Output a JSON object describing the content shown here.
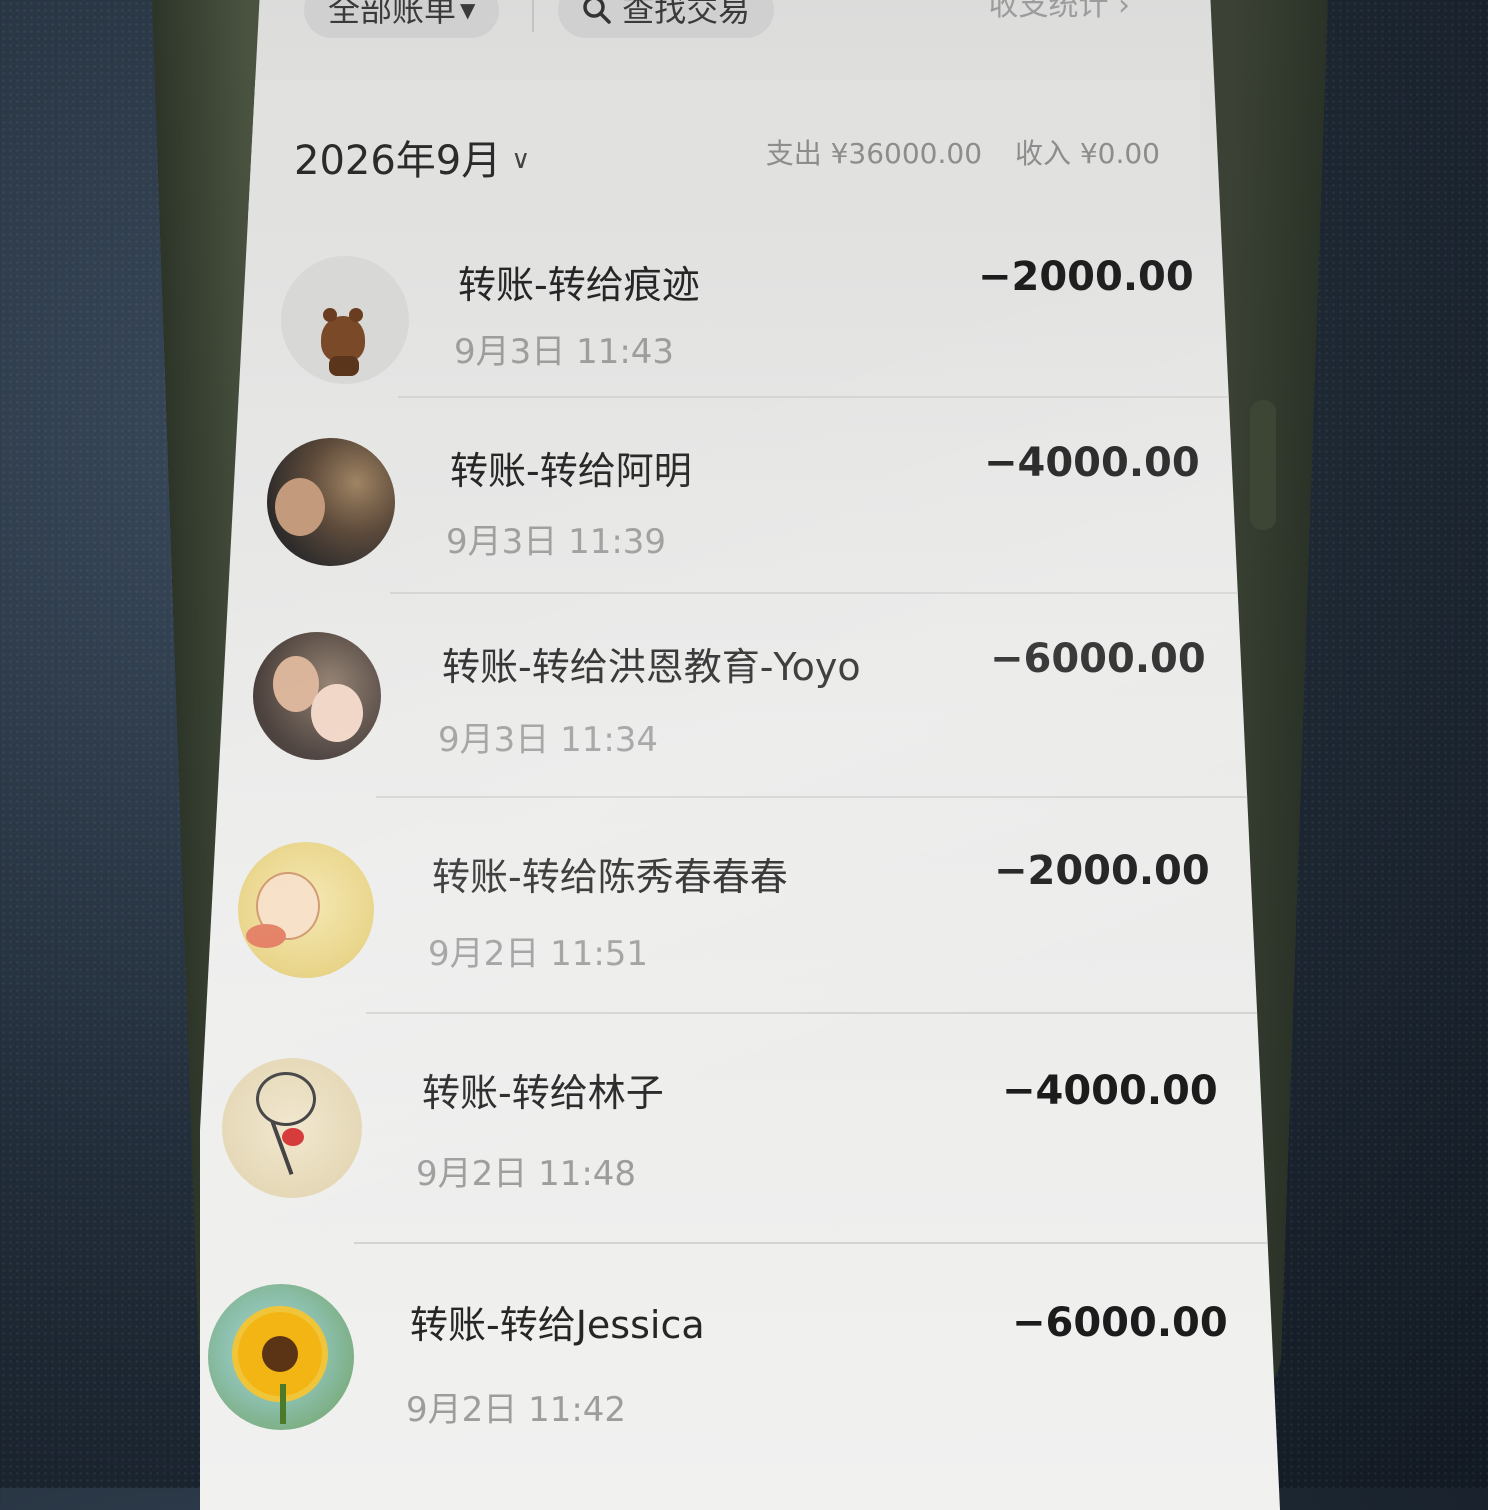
{
  "top_bar": {
    "all_bills_label": "全部账单",
    "search_label": "查找交易",
    "stats_label": "收支统计"
  },
  "month": {
    "label": "2026年9月",
    "expense": "支出 ¥36000.00",
    "income": "收入 ¥0.00"
  },
  "transactions": [
    {
      "title": "转账-转给痕迹",
      "time": "9月3日 11:43",
      "amount": "−2000.00",
      "avatar": "bear-avatar"
    },
    {
      "title": "转账-转给阿明",
      "time": "9月3日 11:39",
      "amount": "−4000.00",
      "avatar": "man-avatar"
    },
    {
      "title": "转账-转给洪恩教育-Yoyo",
      "time": "9月3日 11:34",
      "amount": "−6000.00",
      "avatar": "mother-child-avatar"
    },
    {
      "title": "转账-转给陈秀春春春",
      "time": "9月2日 11:51",
      "amount": "−2000.00",
      "avatar": "cartoon-avatar"
    },
    {
      "title": "转账-转给林子",
      "time": "9月2日 11:48",
      "amount": "−4000.00",
      "avatar": "sketch-avatar"
    },
    {
      "title": "转账-转给Jessica",
      "time": "9月2日 11:42",
      "amount": "−6000.00",
      "avatar": "sunflower-avatar"
    }
  ],
  "colors": {
    "screen_bg": "#ececeb",
    "header_bg": "#e1e1e0",
    "amount_text": "#1c1c1c",
    "time_text": "#9d9d9d"
  }
}
